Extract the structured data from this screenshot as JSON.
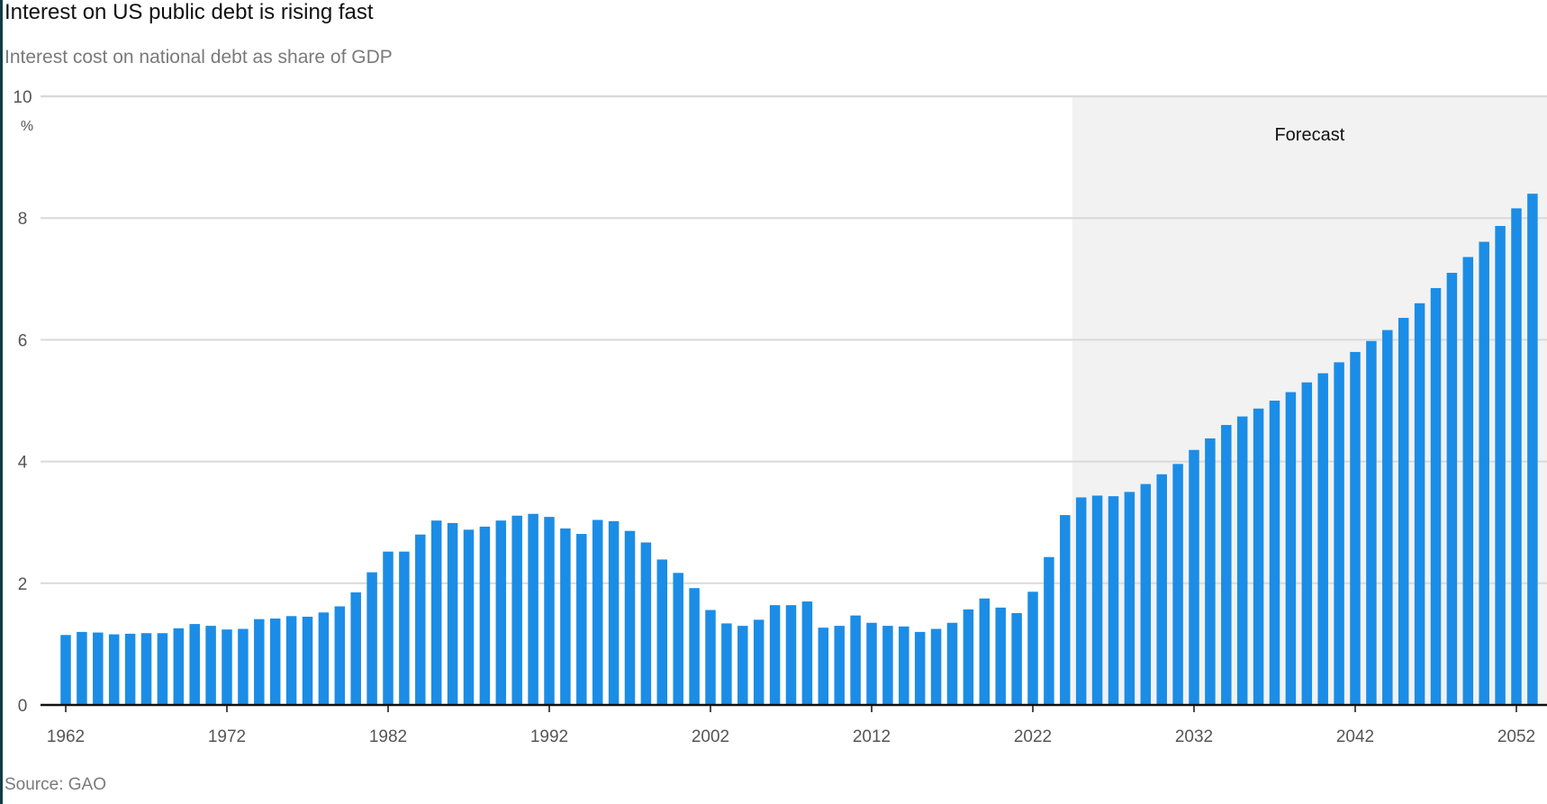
{
  "header": {
    "title": "Interest on US public debt is rising fast",
    "subtitle": "Interest cost on national debt as share of GDP"
  },
  "footer": {
    "source": "Source: GAO"
  },
  "colors": {
    "bar": "#1b8de6",
    "forecast_band": "#f2f2f2",
    "grid": "#d9d9d9",
    "axis": "#111111",
    "tick_text": "#555555"
  },
  "chart_data": {
    "type": "bar",
    "title": "Interest on US public debt is rising fast",
    "subtitle": "Interest cost on national debt as share of GDP",
    "unit_label": "%",
    "ylim": [
      0,
      10
    ],
    "yticks": [
      0,
      2,
      4,
      6,
      8,
      10
    ],
    "xticks": [
      1962,
      1972,
      1982,
      1992,
      2002,
      2012,
      2022,
      2032,
      2042,
      2052
    ],
    "grid": true,
    "forecast_start": 2025,
    "forecast_label": "Forecast",
    "x": [
      1962,
      1963,
      1964,
      1965,
      1966,
      1967,
      1968,
      1969,
      1970,
      1971,
      1972,
      1973,
      1974,
      1975,
      1976,
      1977,
      1978,
      1979,
      1980,
      1981,
      1982,
      1983,
      1984,
      1985,
      1986,
      1987,
      1988,
      1989,
      1990,
      1991,
      1992,
      1993,
      1994,
      1995,
      1996,
      1997,
      1998,
      1999,
      2000,
      2001,
      2002,
      2003,
      2004,
      2005,
      2006,
      2007,
      2008,
      2009,
      2010,
      2011,
      2012,
      2013,
      2014,
      2015,
      2016,
      2017,
      2018,
      2019,
      2020,
      2021,
      2022,
      2023,
      2024,
      2025,
      2026,
      2027,
      2028,
      2029,
      2030,
      2031,
      2032,
      2033,
      2034,
      2035,
      2036,
      2037,
      2038,
      2039,
      2040,
      2041,
      2042,
      2043,
      2044,
      2045,
      2046,
      2047,
      2048,
      2049,
      2050,
      2051,
      2052,
      2053
    ],
    "values": [
      1.15,
      1.2,
      1.19,
      1.16,
      1.17,
      1.18,
      1.18,
      1.26,
      1.33,
      1.3,
      1.24,
      1.25,
      1.41,
      1.42,
      1.46,
      1.45,
      1.52,
      1.62,
      1.85,
      2.18,
      2.52,
      2.52,
      2.8,
      3.03,
      2.99,
      2.88,
      2.93,
      3.03,
      3.11,
      3.14,
      3.09,
      2.9,
      2.81,
      3.04,
      3.02,
      2.86,
      2.67,
      2.39,
      2.17,
      1.92,
      1.56,
      1.34,
      1.3,
      1.4,
      1.64,
      1.64,
      1.7,
      1.27,
      1.3,
      1.47,
      1.35,
      1.3,
      1.29,
      1.2,
      1.25,
      1.35,
      1.57,
      1.75,
      1.6,
      1.51,
      1.86,
      2.43,
      3.12,
      3.41,
      3.44,
      3.43,
      3.5,
      3.63,
      3.79,
      3.96,
      4.19,
      4.38,
      4.6,
      4.74,
      4.87,
      5.0,
      5.14,
      5.3,
      5.45,
      5.63,
      5.8,
      5.98,
      6.16,
      6.36,
      6.6,
      6.85,
      7.1,
      7.36,
      7.61,
      7.87,
      8.16,
      8.4
    ]
  }
}
